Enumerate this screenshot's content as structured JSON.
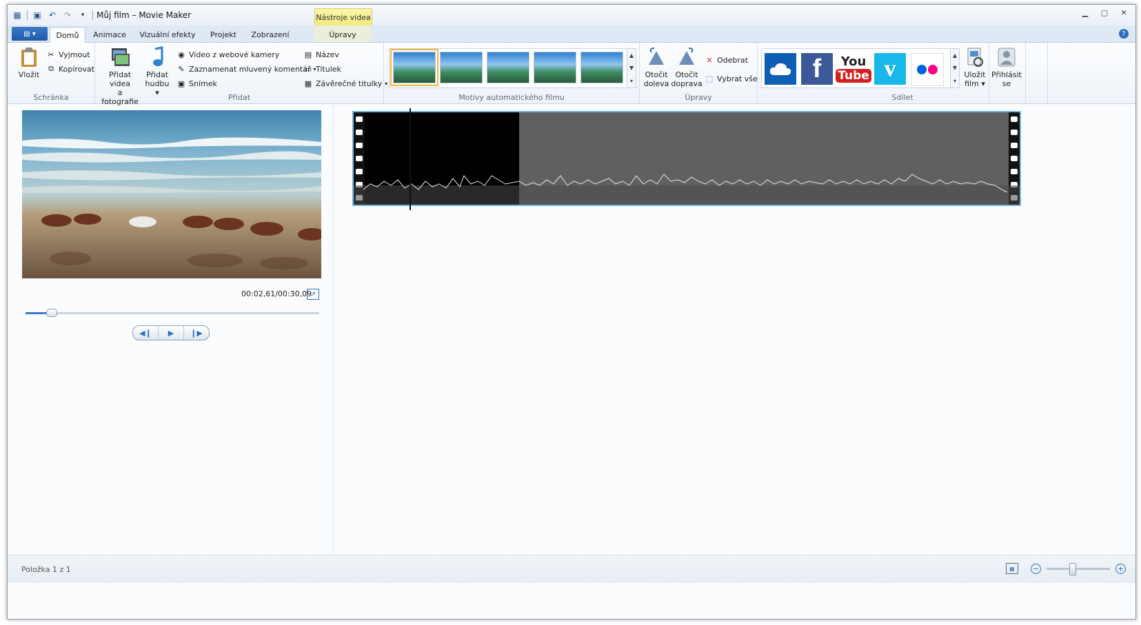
{
  "window": {
    "title": "Můj film – Movie Maker",
    "contextual_tab": "Nástroje videa"
  },
  "tabs": [
    {
      "label": "Domů",
      "active": true
    },
    {
      "label": "Animace"
    },
    {
      "label": "Vizuální efekty"
    },
    {
      "label": "Projekt"
    },
    {
      "label": "Zobrazení"
    },
    {
      "label": "Úpravy"
    }
  ],
  "ribbon": {
    "clipboard": {
      "label": "Schránka",
      "paste": "Vložit",
      "cut": "Vyjmout",
      "copy": "Kopírovat"
    },
    "add": {
      "label": "Přidat",
      "add_videos_1": "Přidat videa",
      "add_videos_2": "a fotografie",
      "add_music_1": "Přidat",
      "add_music_2": "hudbu",
      "webcam": "Video z webové kamery",
      "narration": "Zaznamenat mluvený komentář",
      "snapshot": "Snímek",
      "title": "Název",
      "caption": "Titulek",
      "credits": "Závěrečné titulky"
    },
    "themes": {
      "label": "Motivy automatického filmu"
    },
    "edit": {
      "label": "Úpravy",
      "rotate_left_1": "Otočit",
      "rotate_left_2": "doleva",
      "rotate_right_1": "Otočit",
      "rotate_right_2": "doprava",
      "remove": "Odebrat",
      "select_all": "Vybrat vše"
    },
    "share": {
      "label": "Sdílet",
      "save_1": "Uložit",
      "save_2": "film",
      "signin_1": "Přihlásit",
      "signin_2": "se",
      "services": [
        {
          "name": "onedrive-icon",
          "color": "#0f5db5"
        },
        {
          "name": "facebook-icon",
          "color": "#3b5998"
        },
        {
          "name": "youtube-icon",
          "color": "#ffffff"
        },
        {
          "name": "vimeo-icon",
          "color": "#1ab7ea"
        },
        {
          "name": "flickr-icon",
          "color": "#ffffff"
        }
      ],
      "youtube_top": "You",
      "youtube_bottom": "Tube"
    }
  },
  "player": {
    "timecode": "00:02,61/00:30,09",
    "progress": 0.087
  },
  "storyboard": {
    "accent": "#6fb3e0"
  },
  "status": {
    "text": "Položka 1 z 1",
    "zoom_level": 0.4
  }
}
